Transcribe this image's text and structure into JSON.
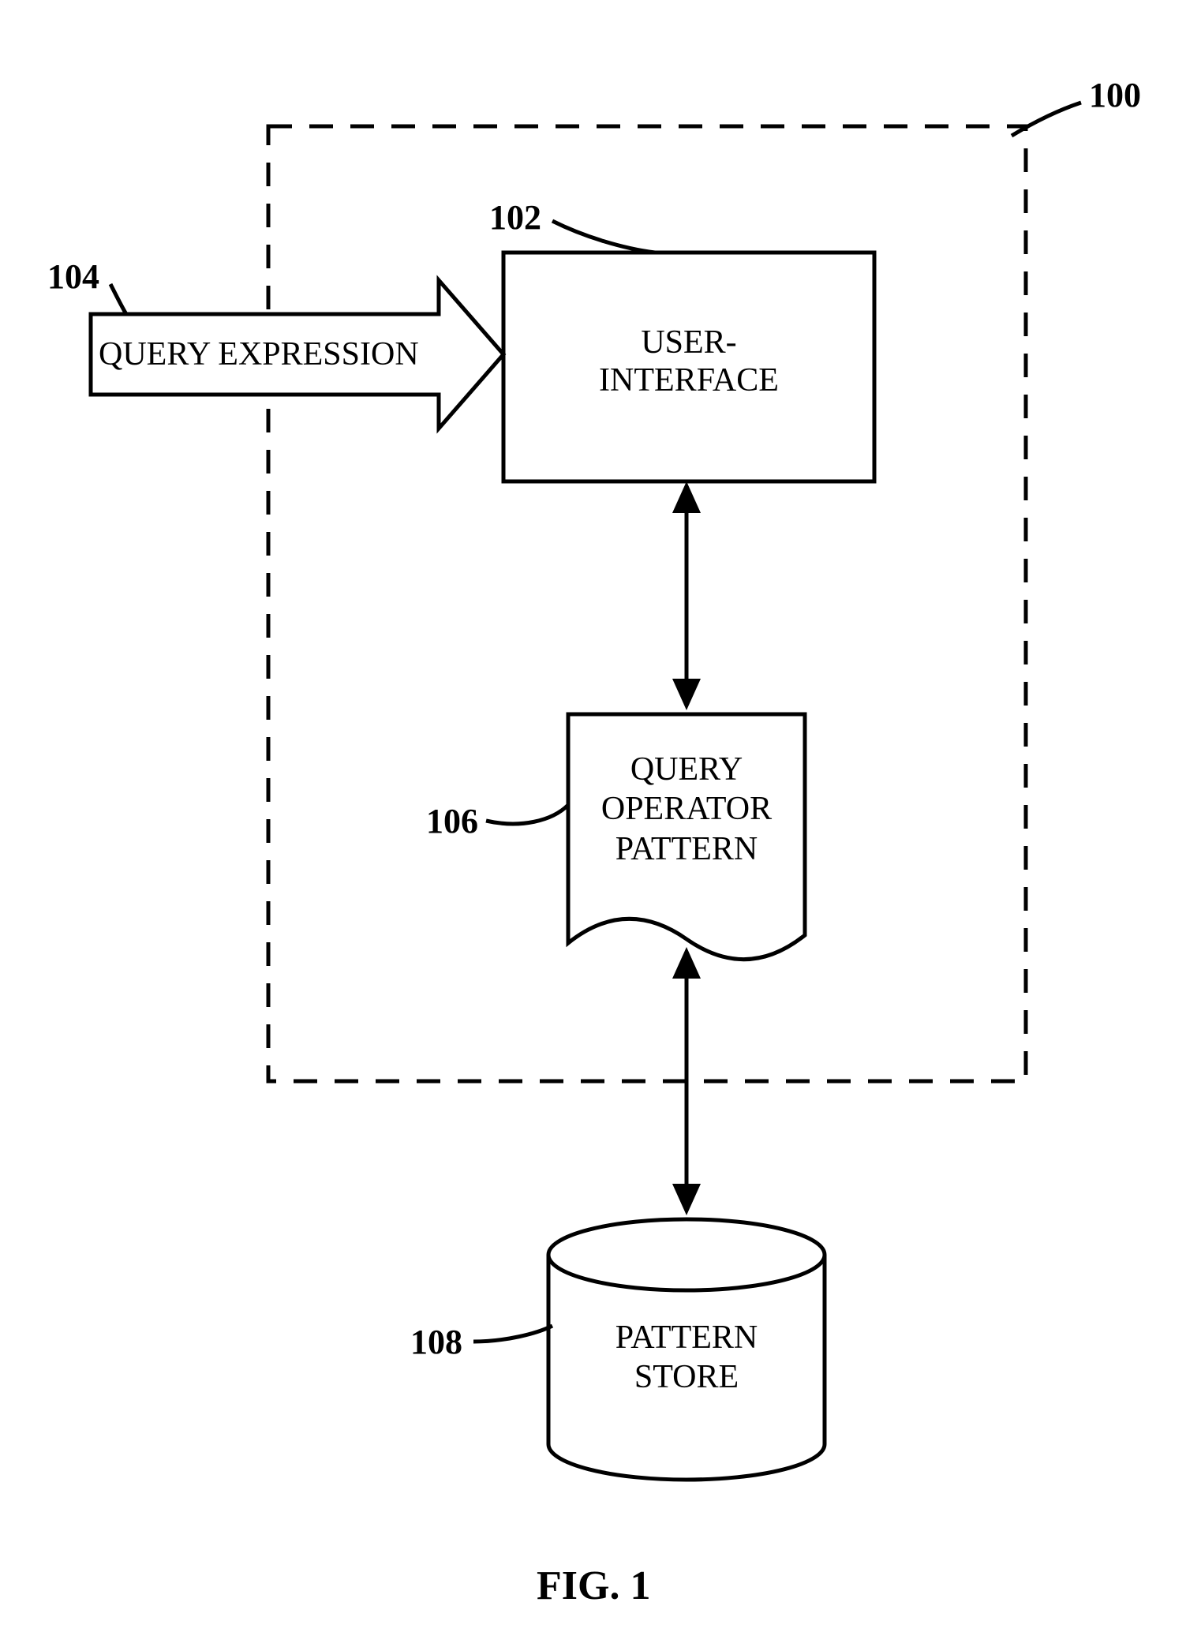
{
  "refs": {
    "system": "100",
    "ui": "102",
    "query_expression": "104",
    "pattern": "106",
    "store": "108"
  },
  "blocks": {
    "query_expression": "QUERY EXPRESSION",
    "user_interface": "USER-\nINTERFACE",
    "query_operator_pattern": "QUERY\nOPERATOR\nPATTERN",
    "pattern_store": "PATTERN\nSTORE"
  },
  "caption": "FIG. 1"
}
